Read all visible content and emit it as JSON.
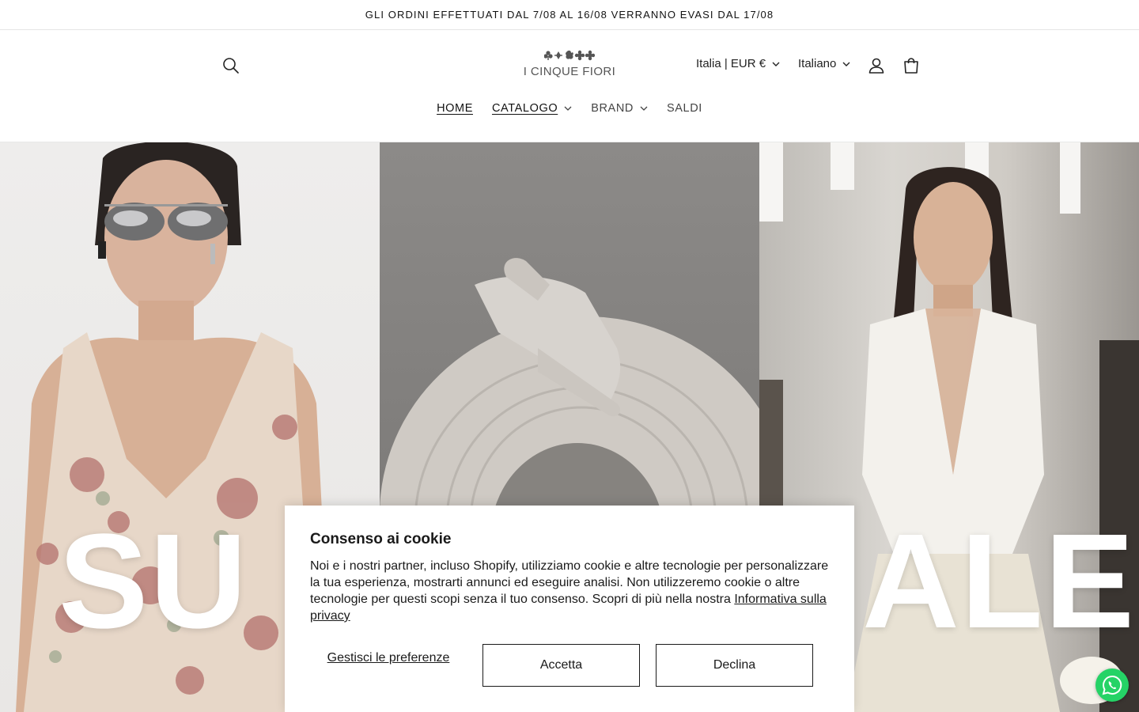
{
  "announcement": {
    "text": "GLI ORDINI EFFETTUATI DAL 7/08 AL 16/08 VERRANNO EVASI DAL 17/08"
  },
  "header": {
    "logo_text": "I CINQUE FIORI",
    "country_selector": "Italia | EUR €",
    "language_selector": "Italiano",
    "icons": [
      "search-icon",
      "account-icon",
      "cart-icon"
    ]
  },
  "nav": {
    "items": [
      {
        "label": "HOME",
        "has_dropdown": false,
        "active": true
      },
      {
        "label": "CATALOGO",
        "has_dropdown": true,
        "active": false
      },
      {
        "label": "BRAND",
        "has_dropdown": true,
        "active": false
      },
      {
        "label": "SALDI",
        "has_dropdown": false,
        "active": false
      }
    ]
  },
  "hero": {
    "left_word": "SU",
    "right_word": "ALE"
  },
  "cookie_banner": {
    "title": "Consenso ai cookie",
    "body": "Noi e i nostri partner, incluso Shopify, utilizziamo cookie e altre tecnologie per personalizzare la tua esperienza, mostrarti annunci ed eseguire analisi. Non utilizzeremo cookie o altre tecnologie per questi scopi senza il tuo consenso. Scopri di più nella nostra ",
    "privacy_link": "Informativa sulla privacy",
    "manage_label": "Gestisci le preferenze",
    "accept_label": "Accetta",
    "decline_label": "Declina"
  },
  "colors": {
    "text": "#121212",
    "whatsapp": "#25d366",
    "border": "#1a1a1a"
  }
}
